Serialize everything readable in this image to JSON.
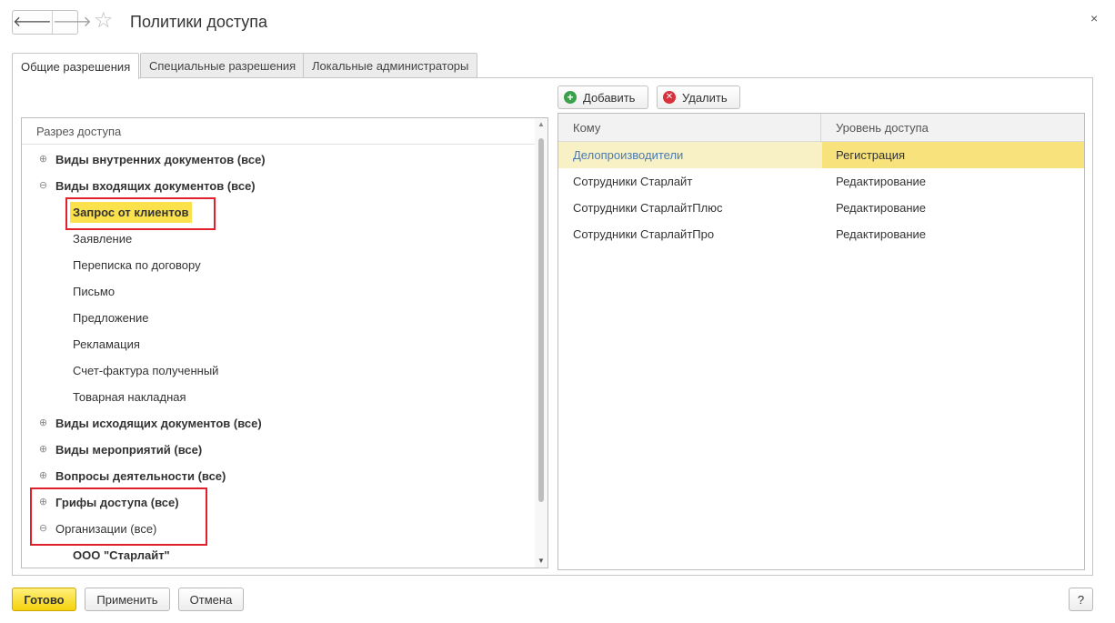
{
  "window": {
    "title": "Политики доступа",
    "back_glyph": "🡐",
    "forward_glyph": "🡒",
    "favorite_glyph": "☆",
    "close_glyph": "×"
  },
  "tabs": [
    {
      "label": "Общие разрешения",
      "active": true
    },
    {
      "label": "Специальные разрешения",
      "active": false
    },
    {
      "label": "Локальные администраторы",
      "active": false
    }
  ],
  "tree": {
    "header": "Разрез доступа",
    "scroll_up_glyph": "▲",
    "scroll_down_glyph": "▼",
    "rows": [
      {
        "label": "Виды внутренних документов (все)",
        "level": 0,
        "toggle": "⊕",
        "bold": true
      },
      {
        "label": "Виды входящих документов (все)",
        "level": 0,
        "toggle": "⊖",
        "bold": true
      },
      {
        "label": "Запрос от клиентов",
        "level": 1,
        "toggle": "",
        "bold": true,
        "selected": true
      },
      {
        "label": "Заявление",
        "level": 1,
        "toggle": "",
        "bold": false
      },
      {
        "label": "Переписка по договору",
        "level": 1,
        "toggle": "",
        "bold": false
      },
      {
        "label": "Письмо",
        "level": 1,
        "toggle": "",
        "bold": false
      },
      {
        "label": "Предложение",
        "level": 1,
        "toggle": "",
        "bold": false
      },
      {
        "label": "Рекламация",
        "level": 1,
        "toggle": "",
        "bold": false
      },
      {
        "label": "Счет-фактура полученный",
        "level": 1,
        "toggle": "",
        "bold": false
      },
      {
        "label": "Товарная накладная",
        "level": 1,
        "toggle": "",
        "bold": false
      },
      {
        "label": "Виды исходящих документов (все)",
        "level": 0,
        "toggle": "⊕",
        "bold": true
      },
      {
        "label": "Виды мероприятий (все)",
        "level": 0,
        "toggle": "⊕",
        "bold": true
      },
      {
        "label": "Вопросы деятельности (все)",
        "level": 0,
        "toggle": "⊕",
        "bold": true
      },
      {
        "label": "Грифы доступа (все)",
        "level": 0,
        "toggle": "⊕",
        "bold": true
      },
      {
        "label": "Организации (все)",
        "level": 0,
        "toggle": "⊖",
        "bold": false
      },
      {
        "label": "ООО \"Старлайт\"",
        "level": 1,
        "toggle": "",
        "bold": true
      }
    ]
  },
  "toolbar": {
    "add_label": "Добавить",
    "add_icon": "+",
    "delete_label": "Удалить",
    "delete_icon": "✕"
  },
  "table": {
    "columns": [
      "Кому",
      "Уровень доступа"
    ],
    "rows": [
      {
        "to": "Делопроизводители",
        "level": "Регистрация",
        "selected": true
      },
      {
        "to": "Сотрудники Старлайт",
        "level": "Редактирование",
        "selected": false
      },
      {
        "to": "Сотрудники СтарлайтПлюс",
        "level": "Редактирование",
        "selected": false
      },
      {
        "to": "Сотрудники СтарлайтПро",
        "level": "Редактирование",
        "selected": false
      }
    ]
  },
  "footer": {
    "ok_label": "Готово",
    "apply_label": "Применить",
    "cancel_label": "Отмена",
    "help_label": "?"
  },
  "colors": {
    "accent_yellow": "#f5d20e",
    "highlight_red": "#e0202a",
    "selected_row": "#f8f1c6",
    "link_blue": "#4a7bb0"
  }
}
